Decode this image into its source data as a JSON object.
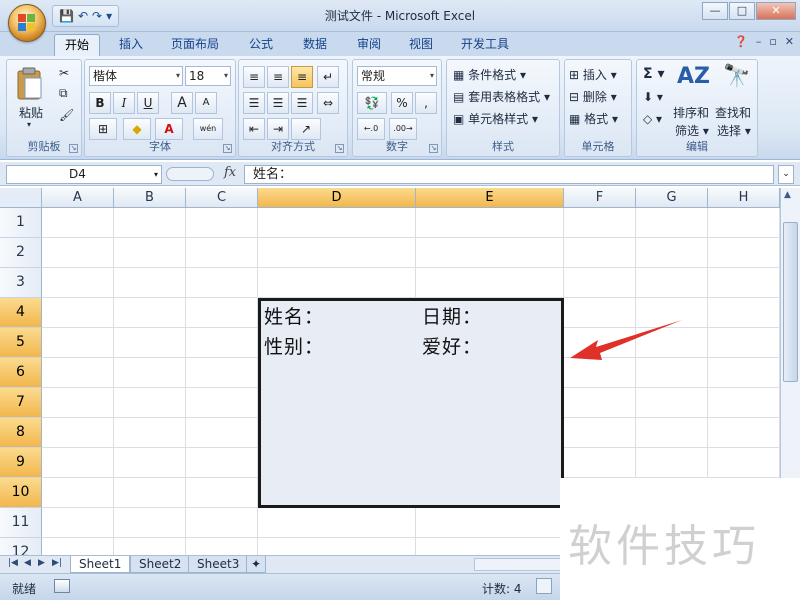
{
  "window": {
    "title": "测试文件 - Microsoft Excel",
    "controls": [
      "—",
      "□",
      "✕"
    ]
  },
  "qat": {
    "save": "💾",
    "undo": "↶",
    "redo": "↷",
    "more": "▾"
  },
  "ribbon_tabs": [
    "开始",
    "插入",
    "页面布局",
    "公式",
    "数据",
    "审阅",
    "视图",
    "开发工具"
  ],
  "ribbon": {
    "clipboard": {
      "label": "剪贴板",
      "paste": "粘贴"
    },
    "font": {
      "label": "字体",
      "name": "楷体",
      "size": "18",
      "bold": "B",
      "italic": "I",
      "underline": "U",
      "grow": "A",
      "shrink": "A",
      "font_color": "A",
      "phonetic": "wén"
    },
    "alignment": {
      "label": "对齐方式"
    },
    "number": {
      "label": "数字",
      "format": "常规",
      "percent": "%",
      "comma": ","
    },
    "styles": {
      "label": "样式",
      "conditional": "条件格式",
      "table": "套用表格格式",
      "cell_styles": "单元格样式"
    },
    "cells": {
      "label": "单元格",
      "insert": "插入",
      "delete": "删除",
      "format": "格式"
    },
    "editing": {
      "label": "编辑",
      "sort_line1": "排序和",
      "sort_line2": "筛选",
      "find_line1": "查找和",
      "find_line2": "选择"
    }
  },
  "formula_bar": {
    "name_box": "D4",
    "fx": "fx",
    "content": "姓名："
  },
  "columns": [
    "A",
    "B",
    "C",
    "D",
    "E",
    "F",
    "G",
    "H"
  ],
  "rows": [
    "1",
    "2",
    "3",
    "4",
    "5",
    "6",
    "7",
    "8",
    "9",
    "10",
    "11",
    "12"
  ],
  "cells": {
    "D4": "姓名：",
    "E4": "日期：",
    "D5": "性别：",
    "E5": "爱好："
  },
  "sheets": [
    "Sheet1",
    "Sheet2",
    "Sheet3"
  ],
  "status": {
    "ready": "就绪",
    "count": "计数: 4"
  },
  "watermark": "软件技巧",
  "colors": {
    "accent": "#f2b64c",
    "selection_border": "#1a1a1a",
    "arrow": "#e0302a"
  }
}
